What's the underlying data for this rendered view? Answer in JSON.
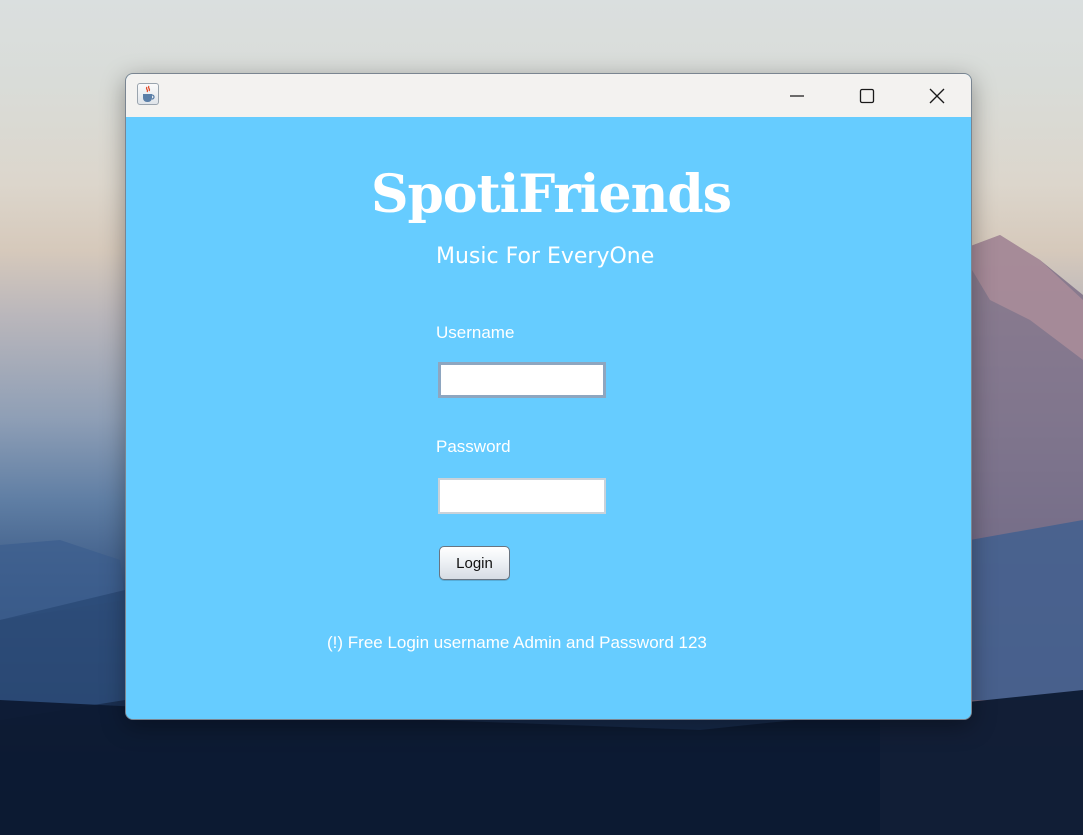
{
  "window": {
    "icon": "java-cup-icon",
    "controls": {
      "minimize_icon": "minimize-icon",
      "maximize_icon": "maximize-icon",
      "close_icon": "close-icon"
    }
  },
  "login": {
    "title": "SpotiFriends",
    "subtitle": "Music For EveryOne",
    "username_label": "Username",
    "username_value": "",
    "password_label": "Password",
    "password_value": "",
    "login_button": "Login",
    "hint": "(!) Free Login username Admin and Password 123"
  },
  "colors": {
    "content_background": "#66ccff",
    "titlebar_background": "#f3f2f0",
    "text": "#ffffff"
  }
}
